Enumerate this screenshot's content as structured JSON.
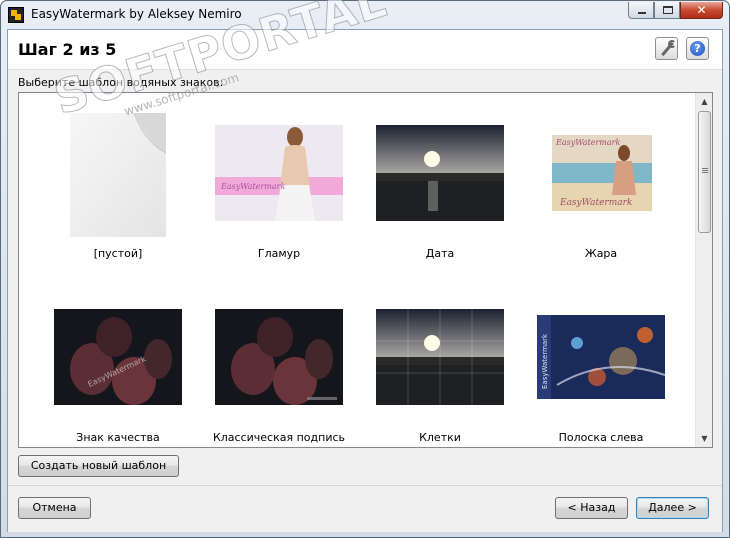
{
  "window": {
    "title": "EasyWatermark by Aleksey Nemiro",
    "close_glyph": "✕"
  },
  "header": {
    "step_title": "Шаг 2 из 5",
    "help_glyph": "?"
  },
  "prompt": "Выберите шаблон водяных знаков:",
  "templates": [
    {
      "label": "[пустой]"
    },
    {
      "label": "Гламур",
      "thumb_text": "EasyWatermark"
    },
    {
      "label": "Дата"
    },
    {
      "label": "Жара",
      "thumb_text_top": "EasyWatermark",
      "thumb_text_bottom": "EasyWatermark"
    },
    {
      "label": "Знак качества",
      "thumb_text": "EasyWatermark"
    },
    {
      "label": "Классическая подпись"
    },
    {
      "label": "Клетки"
    },
    {
      "label": "Полоска слева",
      "thumb_text": "EasyWatermark"
    }
  ],
  "scrollbar": {
    "up": "▲",
    "down": "▼"
  },
  "buttons": {
    "new_template": "Создать новый шаблон",
    "cancel": "Отмена",
    "back": "< Назад",
    "next": "Далее >"
  },
  "overlay_watermark": {
    "main": "SOFTPORTAL",
    "sub": "www.softportal.com"
  },
  "colors": {
    "accent_default_button": "#3c7fb1",
    "close_button": "#c84a32"
  }
}
